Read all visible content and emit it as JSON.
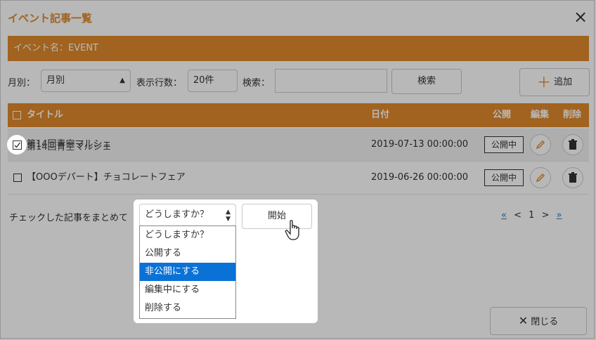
{
  "dialog": {
    "title": "イベント記事一覧",
    "close_label": "×",
    "event_name": "イベント名：EVENT"
  },
  "filters": {
    "month_label": "月別：",
    "month_value": "月別",
    "rows_label": "表示行数：",
    "rows_value": "20件",
    "search_label": "検索：",
    "search_value": "",
    "search_button": "検索",
    "add_button": "追加"
  },
  "table": {
    "headers": {
      "title": "タイトル",
      "date": "日付",
      "publish": "公開",
      "edit": "編集",
      "delete": "削除"
    },
    "rows": [
      {
        "title": "第14回青空マルシェ",
        "date": "2019-07-13 00:00:00",
        "status": "公開中",
        "checked": true
      },
      {
        "title": "【OOOデパート】チョコレートフェア",
        "date": "2019-06-26 00:00:00",
        "status": "公開中",
        "checked": false
      }
    ]
  },
  "bulk": {
    "label": "チェックした記事をまとめて",
    "select_value": "どうしますか？",
    "options": [
      "どうしますか？",
      "公開する",
      "非公開にする",
      "編集中にする",
      "削除する"
    ],
    "highlighted_index": 2,
    "start_button": "開始"
  },
  "pager": {
    "first": "«",
    "prev": "<",
    "current": "1",
    "next": ">",
    "last": "»"
  },
  "footer": {
    "close_button": "閉じる"
  },
  "colors": {
    "accent": "#e08a2c",
    "highlight": "#0a72d6",
    "link": "#337ab7"
  }
}
